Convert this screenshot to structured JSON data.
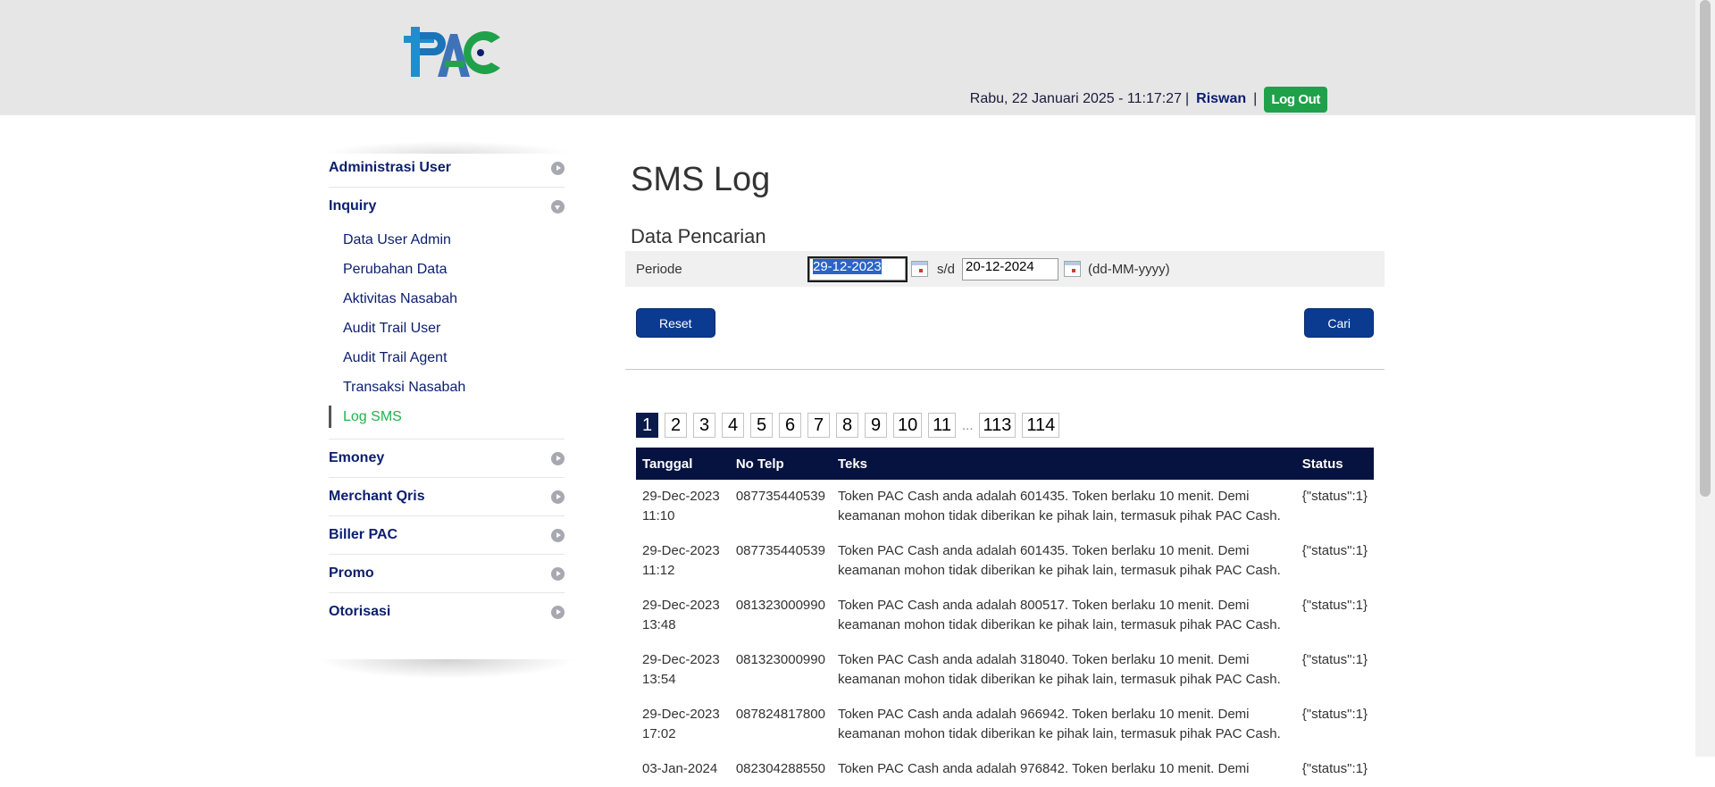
{
  "header": {
    "logo_text": "PAC",
    "datetime": "Rabu, 22 Januari 2025 - 11:17:27",
    "separator": "|",
    "username": "Riswan",
    "logout_label": "Log Out"
  },
  "sidebar": {
    "groups": [
      {
        "label": "Administrasi User",
        "expanded": false
      },
      {
        "label": "Inquiry",
        "expanded": true,
        "items": [
          {
            "label": "Data User Admin"
          },
          {
            "label": "Perubahan Data"
          },
          {
            "label": "Aktivitas Nasabah"
          },
          {
            "label": "Audit Trail User"
          },
          {
            "label": "Audit Trail Agent"
          },
          {
            "label": "Transaksi Nasabah"
          },
          {
            "label": "Log SMS",
            "active": true
          }
        ]
      },
      {
        "label": "Emoney",
        "expanded": false
      },
      {
        "label": "Merchant Qris",
        "expanded": false
      },
      {
        "label": "Biller PAC",
        "expanded": false
      },
      {
        "label": "Promo",
        "expanded": false
      },
      {
        "label": "Otorisasi",
        "expanded": false
      }
    ]
  },
  "main": {
    "title": "SMS Log",
    "section_title": "Data Pencarian",
    "filter": {
      "label": "Periode",
      "start_date": "29-12-2023",
      "separator": "s/d",
      "end_date": "20-12-2024",
      "format_hint": "(dd-MM-yyyy)"
    },
    "reset_label": "Reset",
    "search_label": "Cari",
    "pagination": {
      "pages": [
        "1",
        "2",
        "3",
        "4",
        "5",
        "6",
        "7",
        "8",
        "9",
        "10",
        "11"
      ],
      "current": "1",
      "ellipsis": "...",
      "last_pages": [
        "113",
        "114"
      ]
    },
    "table": {
      "headers": [
        "Tanggal",
        "No Telp",
        "Teks",
        "Status"
      ],
      "rows": [
        {
          "date": "29-Dec-2023",
          "time": "11:10",
          "telp": "087735440539",
          "teks": "Token PAC Cash anda adalah 601435. Token berlaku 10 menit. Demi keamanan mohon tidak diberikan ke pihak lain, termasuk pihak PAC Cash.",
          "status": "{\"status\":1}"
        },
        {
          "date": "29-Dec-2023",
          "time": "11:12",
          "telp": "087735440539",
          "teks": "Token PAC Cash anda adalah 601435. Token berlaku 10 menit. Demi keamanan mohon tidak diberikan ke pihak lain, termasuk pihak PAC Cash.",
          "status": "{\"status\":1}"
        },
        {
          "date": "29-Dec-2023",
          "time": "13:48",
          "telp": "081323000990",
          "teks": "Token PAC Cash anda adalah 800517. Token berlaku 10 menit. Demi keamanan mohon tidak diberikan ke pihak lain, termasuk pihak PAC Cash.",
          "status": "{\"status\":1}"
        },
        {
          "date": "29-Dec-2023",
          "time": "13:54",
          "telp": "081323000990",
          "teks": "Token PAC Cash anda adalah 318040. Token berlaku 10 menit. Demi keamanan mohon tidak diberikan ke pihak lain, termasuk pihak PAC Cash.",
          "status": "{\"status\":1}"
        },
        {
          "date": "29-Dec-2023",
          "time": "17:02",
          "telp": "087824817800",
          "teks": "Token PAC Cash anda adalah 966942. Token berlaku 10 menit. Demi keamanan mohon tidak diberikan ke pihak lain, termasuk pihak PAC Cash.",
          "status": "{\"status\":1}"
        },
        {
          "date": "03-Jan-2024",
          "time": "",
          "telp": "082304288550",
          "teks": "Token PAC Cash anda adalah 976842. Token berlaku 10 menit. Demi",
          "status": "{\"status\":1}"
        }
      ]
    }
  },
  "colors": {
    "header_bg": "#e7e6e7",
    "brand_navy": "#0b1e6e",
    "table_header": "#061340",
    "button_blue": "#0b3a91",
    "logout_green": "#1fa14a",
    "active_green": "#21b24a"
  }
}
